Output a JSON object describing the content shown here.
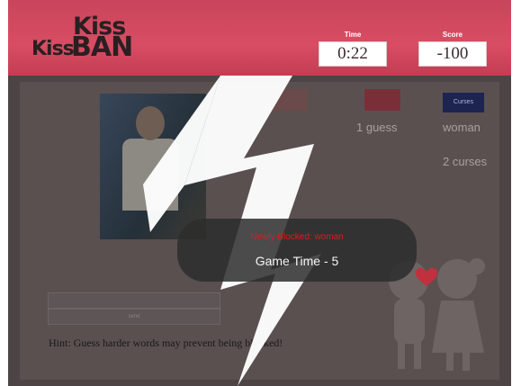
{
  "logo": {
    "line1": "Kiss",
    "line2": "Kiss",
    "line3": "BAN"
  },
  "stats": {
    "time_label": "Time",
    "time_value": "0:22",
    "score_label": "Score",
    "score_value": "-100"
  },
  "buttons": {
    "curses": "Curses"
  },
  "texts": {
    "guesses": "1 guess",
    "curse_word": "woman",
    "curse_count": "2 curses",
    "bar_label": "send"
  },
  "hint": "Hint: Guess harder words may prevent being blocked!",
  "popup": {
    "blocked_line": "Newly Blocked: woman",
    "game_line": "Game Time - 5"
  },
  "colors": {
    "header": "#d84d63",
    "accent_red": "#e01a1a",
    "curses_btn": "#1d2450"
  }
}
